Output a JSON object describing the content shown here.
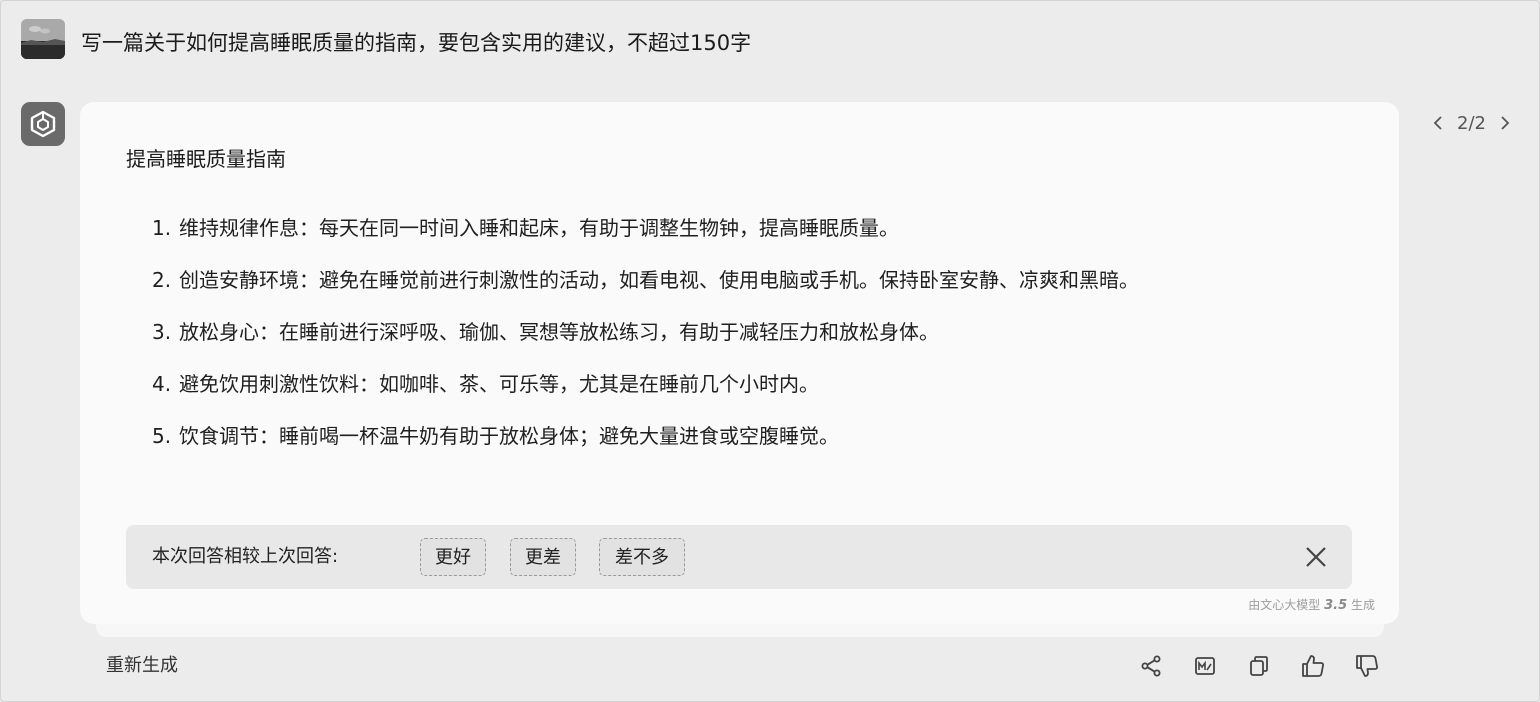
{
  "user": {
    "avatar_icon": "user-photo-avatar",
    "prompt": "写一篇关于如何提高睡眠质量的指南，要包含实用的建议，不超过150字"
  },
  "bot": {
    "avatar_icon": "cube-logo-icon"
  },
  "version_nav": {
    "label": "2/2",
    "prev_icon": "chevron-left-icon",
    "next_icon": "chevron-right-icon"
  },
  "answer": {
    "title": "提高睡眠质量指南",
    "items": [
      {
        "num": "1.",
        "text": "维持规律作息：每天在同一时间入睡和起床，有助于调整生物钟，提高睡眠质量。"
      },
      {
        "num": "2.",
        "text": "创造安静环境：避免在睡觉前进行刺激性的活动，如看电视、使用电脑或手机。保持卧室安静、凉爽和黑暗。"
      },
      {
        "num": "3.",
        "text": "放松身心：在睡前进行深呼吸、瑜伽、冥想等放松练习，有助于减轻压力和放松身体。"
      },
      {
        "num": "4.",
        "text": "避免饮用刺激性饮料：如咖啡、茶、可乐等，尤其是在睡前几个小时内。"
      },
      {
        "num": "5.",
        "text": "饮食调节：睡前喝一杯温牛奶有助于放松身体；避免大量进食或空腹睡觉。"
      }
    ]
  },
  "feedback": {
    "label": "本次回答相较上次回答:",
    "options": [
      "更好",
      "更差",
      "差不多"
    ],
    "close_icon": "close-icon"
  },
  "model_credit": {
    "prefix": "由文心大模型",
    "version": "3.5",
    "suffix": "生成"
  },
  "toolbar": {
    "regenerate_label": "重新生成",
    "icons": [
      "share-icon",
      "image-icon",
      "copy-icon",
      "thumbs-up-icon",
      "thumbs-down-icon"
    ]
  }
}
